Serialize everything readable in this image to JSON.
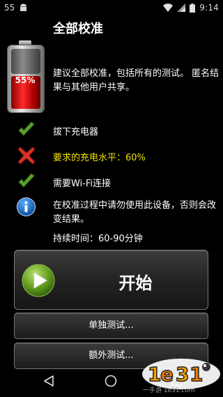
{
  "status_bar": {
    "notification_count": "55",
    "time": "9:14",
    "icons": [
      "android-icon",
      "wifi-icon",
      "signal-icon",
      "battery-icon"
    ]
  },
  "header": {
    "title": "全部校准"
  },
  "battery": {
    "level": 55,
    "label": "55%"
  },
  "description": "建议全部校准，包括所有的测试。 匿名结果与其他用户共享。",
  "requirements": [
    {
      "icon": "check-icon",
      "status": "ok",
      "text": "拔下充电器",
      "color": "#ffffff"
    },
    {
      "icon": "cross-icon",
      "status": "fail",
      "text": "要求的充电水平：60%",
      "color": "#f0e000"
    },
    {
      "icon": "check-icon",
      "status": "ok",
      "text": "需要Wi-Fi连接",
      "color": "#ffffff"
    }
  ],
  "info": {
    "icon": "info-icon",
    "text": "在校准过程中请勿使用此设备，否则会改变结果。",
    "duration": "持续时间：60-90分钟"
  },
  "buttons": {
    "start_label": "开始",
    "single_test_label": "单独测试...",
    "extra_test_label": "额外测试..."
  },
  "watermark": {
    "logo_text": "1e31",
    "site_text": "一手游 1e31.com"
  },
  "colors": {
    "background": "#000000",
    "warning_text": "#f0e000",
    "check_green": "#5aa02c",
    "cross_red": "#d8322a",
    "info_blue": "#1d6fc4",
    "battery_red": "#e01818"
  }
}
